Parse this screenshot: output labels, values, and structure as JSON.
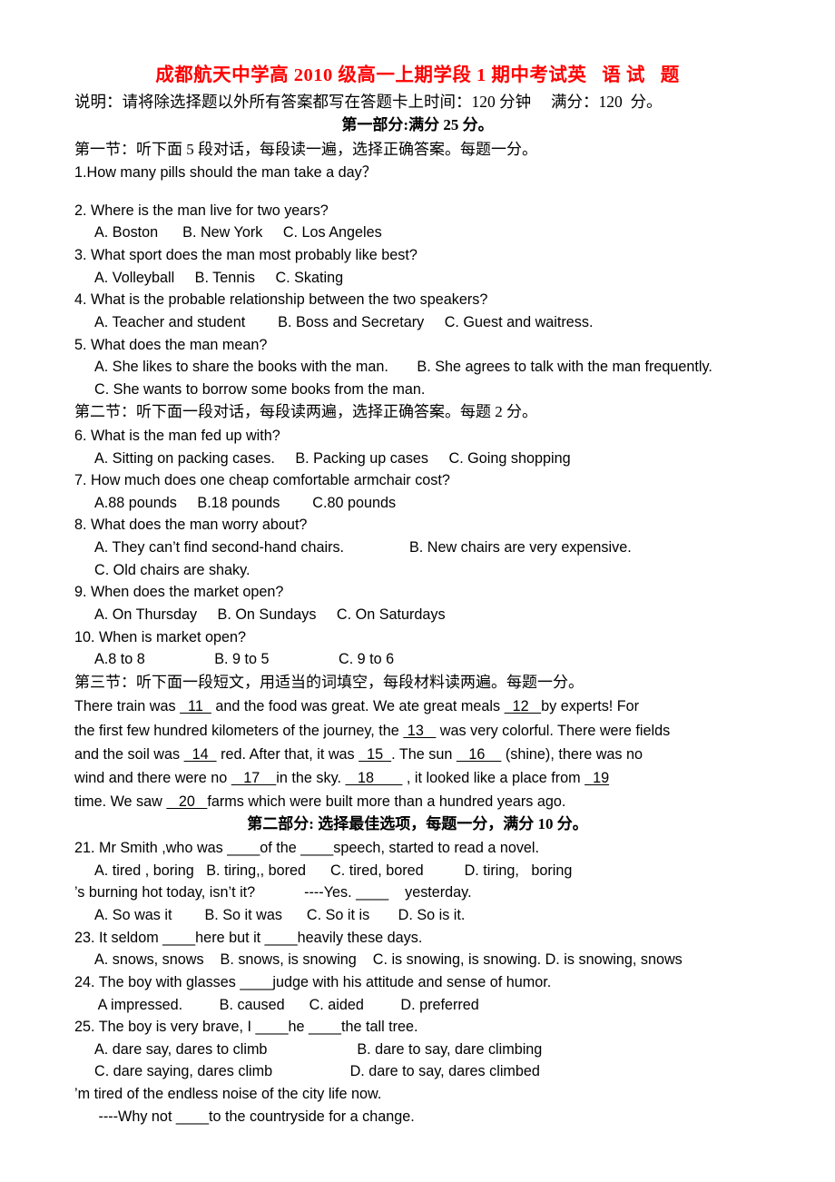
{
  "document": {
    "title": "成都航天中学高 2010 级高一上期学段 1 期中考试英   语 试   题",
    "instruction": "说明：请将除选择题以外所有答案都写在答题卡上时间：120 分钟     满分：120  分。",
    "part1_heading": "第一部分:满分 25 分。",
    "part2_heading": "第二部分: 选择最佳选项，每题一分，满分 10 分。",
    "section1_note": "第一节：听下面 5 段对话，每段读一遍，选择正确答案。每题一分。",
    "section2_note": "第二节：听下面一段对话，每段读两遍，选择正确答案。每题 2 分。",
    "section3_note": "第三节：听下面一段短文，用适当的词填空，每段材料读两遍。每题一分。",
    "title_color": "#FF0000"
  },
  "listening_part1": [
    {
      "question": "1.How many pills should the man take a day？",
      "options": ""
    },
    {
      "question": "2. Where is the man live for two years?",
      "options": "A. Boston      B. New York     C. Los Angeles"
    },
    {
      "question": "3. What sport does the man most probably like best?",
      "options": "A. Volleyball     B. Tennis     C. Skating"
    },
    {
      "question": "4. What is the probable relationship between the two speakers?",
      "options": "A. Teacher and student        B. Boss and Secretary     C. Guest and waitress."
    },
    {
      "question": "5. What does the man mean?",
      "options": "A. She likes to share the books with the man.       B. She agrees to talk with the man frequently.",
      "options2": "C. She wants to borrow some books from the man."
    }
  ],
  "listening_part2": [
    {
      "question": "6. What is the man fed up with?",
      "options": "A. Sitting on packing cases.     B. Packing up cases     C. Going shopping"
    },
    {
      "question": "7. How much does one cheap comfortable armchair cost?",
      "options": "A.88 pounds     B.18 pounds        C.80 pounds"
    },
    {
      "question": "8. What does the man worry about?",
      "options": "A. They can’t find second-hand chairs.                B. New chairs are very expensive.",
      "options2": "C. Old chairs are shaky."
    },
    {
      "question": "9. When does the market open?",
      "options": "A. On Thursday     B. On Sundays     C. On Saturdays"
    },
    {
      "question": "10. When is market open?",
      "options": "A.8 to 8                 B. 9 to 5                 C. 9 to 6"
    }
  ],
  "cloze": {
    "line1_a": "There train was ",
    "line1_blank": "  11  ",
    "line1_b": " and the food was great. We ate great meals ",
    "line1_blank2": "  12   ",
    "line1_c": "by experts! For",
    "line2_a": "the first few hundred kilometers of the journey, the ",
    "line2_blank": " 13   ",
    "line2_b": " was very colorful. There were fields",
    "line3_a": "and the soil was ",
    "line3_blank": "  14  ",
    "line3_b": " red. After that, it was ",
    "line3_blank2": "  15  ",
    "line3_c": ". The sun ",
    "line3_blank3": "   16    ",
    "line3_d": " (shine), there was no",
    "line4_a": "wind and there were no ",
    "line4_blank": "   17    ",
    "line4_b": "in the sky. ",
    "line4_blank2": "   18       ",
    "line4_c": " , it looked like a place from ",
    "line4_blank3": "  19",
    "line5_a": "time. We saw ",
    "line5_blank": "   20   ",
    "line5_b": "farms which were built more than a hundred years ago."
  },
  "multiple_choice": [
    {
      "question": "21. Mr Smith ,who was ____of the ____speech, started to read a novel.",
      "options": "A. tired , boring   B. tiring,, bored      C. tired, bored          D. tiring,   boring"
    },
    {
      "question": "’s burning hot today, isn’t it?            ----Yes. ____    yesterday.",
      "options": "A. So was it        B. So it was      C. So it is       D. So is it."
    },
    {
      "question": "23. It seldom ____here but it ____heavily these days.",
      "options": "A. snows, snows    B. snows, is snowing    C. is snowing, is snowing. D. is snowing, snows"
    },
    {
      "question": "24. The boy with glasses ____judge with his attitude and sense of humor.",
      "options": " A impressed.         B. caused      C. aided         D. preferred"
    },
    {
      "question": "25. The boy is very brave, I ____he ____the tall tree.",
      "options": "A. dare say, dares to climb                      B. dare to say, dare climbing",
      "options2": "C. dare saying, dares climb                   D. dare to say, dares climbed"
    },
    {
      "question": "’m tired of the endless noise of the city life now.",
      "options": " ----Why not ____to the countryside for a change."
    }
  ]
}
